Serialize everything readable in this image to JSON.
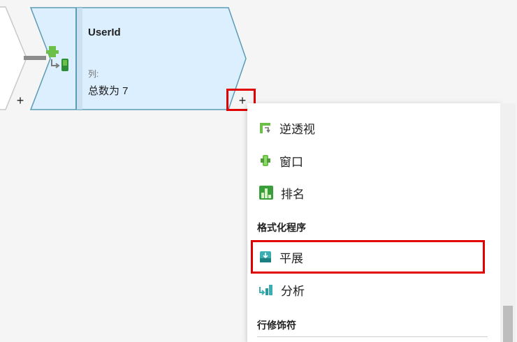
{
  "node": {
    "title": "UserId",
    "sublabel": "列:",
    "summary": "总数为 7",
    "icon": "window-transform-icon",
    "colors": {
      "fill": "#dcefff",
      "border": "#5b9bb5",
      "accent": "#6cc04a"
    }
  },
  "canvas": {
    "add_label": "+",
    "prev_add_label": "+"
  },
  "menu": {
    "items_top": [
      {
        "label": "逆透视",
        "icon": "unpivot-icon"
      },
      {
        "label": "窗口",
        "icon": "window-icon"
      },
      {
        "label": "排名",
        "icon": "rank-icon"
      }
    ],
    "section_formatters": "格式化程序",
    "items_formatters": [
      {
        "label": "平展",
        "icon": "flatten-icon"
      },
      {
        "label": "分析",
        "icon": "parse-icon"
      }
    ],
    "section_row_modifiers": "行修饰符"
  },
  "highlight_color": "#e00000"
}
